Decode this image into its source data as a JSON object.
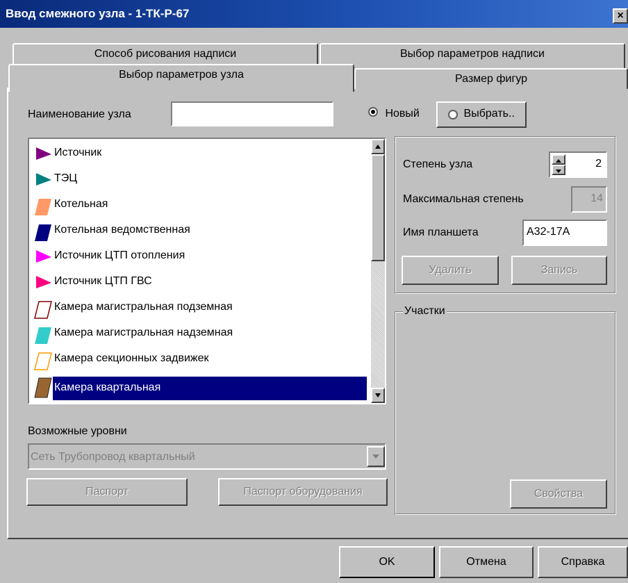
{
  "window": {
    "title": "Ввод смежного узла - 1-ТК-Р-67",
    "close_label": "×"
  },
  "tabs": [
    {
      "label": "Способ рисования надписи"
    },
    {
      "label": "Выбор параметров надписи"
    },
    {
      "label": "Выбор параметров узла"
    },
    {
      "label": "Размер фигур"
    }
  ],
  "node": {
    "name_label": "Наименование узла",
    "name_value": "",
    "radio_new_label": "Новый",
    "radio_select_label": "Выбрать.."
  },
  "node_types": [
    {
      "label": "Источник",
      "color": "#800080",
      "shape": "triangle"
    },
    {
      "label": "ТЭЦ",
      "color": "#008080",
      "shape": "triangle"
    },
    {
      "label": "Котельная",
      "color": "#ff9966",
      "shape": "rhombus"
    },
    {
      "label": "Котельная ведомственная",
      "color": "#000080",
      "shape": "rhombus"
    },
    {
      "label": "Источник ЦТП отопления",
      "color": "#ff00ff",
      "shape": "triangle"
    },
    {
      "label": "Источник ЦТП ГВС",
      "color": "#ff0080",
      "shape": "triangle"
    },
    {
      "label": "Камера магистральная подземная",
      "color": "#800000",
      "shape": "rhombus-outline"
    },
    {
      "label": "Камера магистральная надземная",
      "color": "#33cccc",
      "shape": "rhombus"
    },
    {
      "label": "Камера секционных задвижек",
      "color": "#ff9900",
      "shape": "rhombus-outline"
    },
    {
      "label": "Камера квартальная",
      "color": "#996633",
      "shape": "rhombus",
      "selected": true
    }
  ],
  "levels": {
    "label": "Возможные уровни",
    "selected": "Сеть Трубопровод квартальный"
  },
  "buttons": {
    "passport": "Паспорт",
    "equipment_passport": "Паспорт оборудования",
    "delete": "Удалить",
    "record": "Запись",
    "properties": "Свойства",
    "ok": "OK",
    "cancel": "Отмена",
    "help": "Справка"
  },
  "params": {
    "degree_label": "Степень узла",
    "degree_value": "2",
    "max_degree_label": "Максимальная степень",
    "max_degree_value": "14",
    "tablet_label": "Имя планшета",
    "tablet_value": "А32-17А"
  },
  "sections": {
    "label": "Участки"
  }
}
